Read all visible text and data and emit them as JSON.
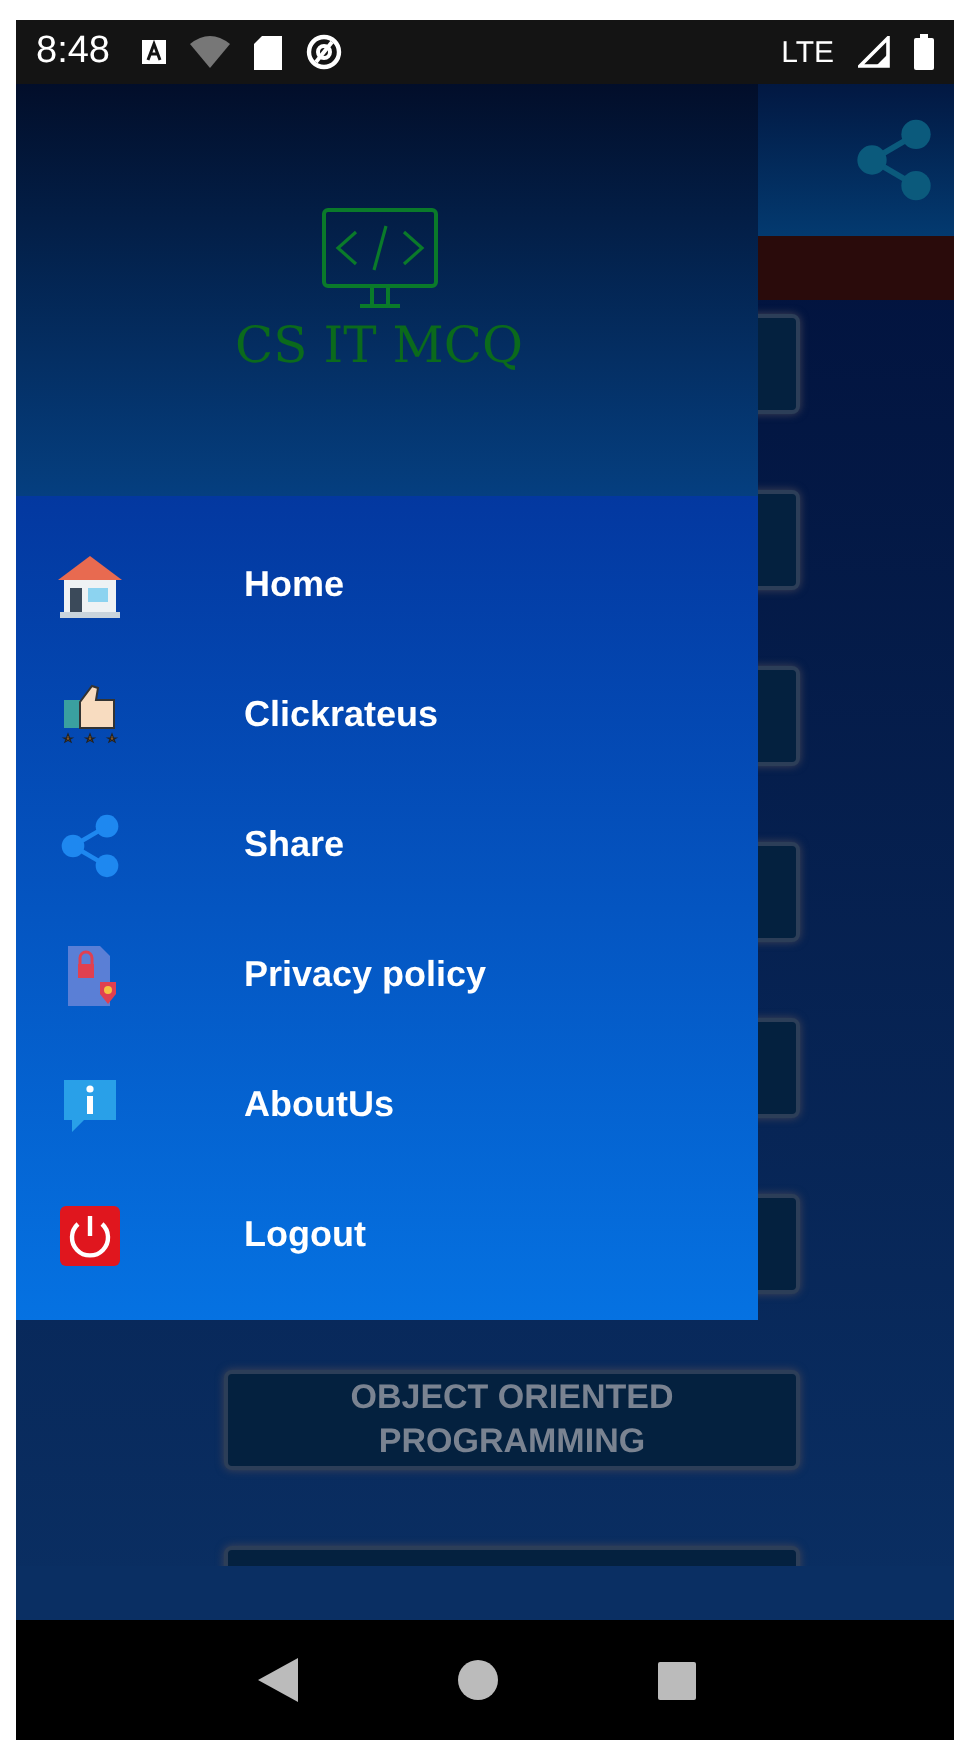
{
  "status_bar": {
    "time": "8:48",
    "network": "LTE"
  },
  "drawer": {
    "app_name": "CS IT MCQ",
    "items": [
      {
        "label": "Home",
        "kind": "home"
      },
      {
        "label": "Clickrateus",
        "kind": "rate"
      },
      {
        "label": "Share",
        "kind": "share"
      },
      {
        "label": "Privacy policy",
        "kind": "privacy"
      },
      {
        "label": "AboutUs",
        "kind": "about"
      },
      {
        "label": "Logout",
        "kind": "logout"
      }
    ]
  },
  "quiz_buttons": [
    {
      "label": "OBJECT ORIENTED PROGRAMMING"
    }
  ]
}
